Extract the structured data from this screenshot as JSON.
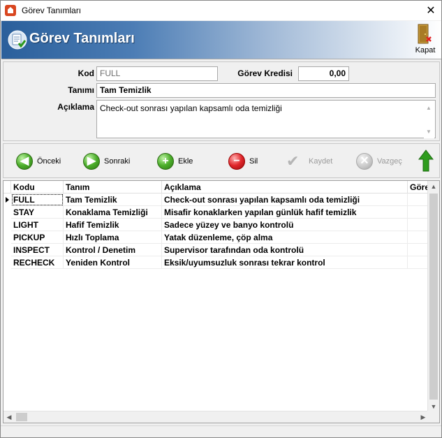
{
  "window": {
    "title": "Görev Tanımları"
  },
  "header": {
    "title": "Görev Tanımları",
    "close_label": "Kapat"
  },
  "form": {
    "kod_label": "Kod",
    "kod_value": "FULL",
    "kredi_label": "Görev Kredisi",
    "kredi_value": "0,00",
    "tanimi_label": "Tanımı",
    "tanimi_value": "Tam Temizlik",
    "aciklama_label": "Açıklama",
    "aciklama_value": "Check-out sonrası yapılan kapsamlı oda temizliği"
  },
  "toolbar": {
    "prev_label": "Önceki",
    "next_label": "Sonraki",
    "add_label": "Ekle",
    "delete_label": "Sil",
    "save_label": "Kaydet",
    "cancel_label": "Vazgeç"
  },
  "grid": {
    "columns": [
      "Kodu",
      "Tanım",
      "Açıklama",
      "Görev Kredisi"
    ],
    "rows": [
      {
        "kod": "FULL",
        "tanim": "Tam Temizlik",
        "aciklama": "Check-out sonrası yapılan kapsamlı oda temizliği"
      },
      {
        "kod": "STAY",
        "tanim": "Konaklama Temizliği",
        "aciklama": "Misafir konaklarken yapılan günlük hafif temizlik"
      },
      {
        "kod": "LIGHT",
        "tanim": "Hafif Temizlik",
        "aciklama": "Sadece yüzey ve banyo kontrolü"
      },
      {
        "kod": "PICKUP",
        "tanim": "Hızlı Toplama",
        "aciklama": "Yatak düzenleme, çöp alma"
      },
      {
        "kod": "INSPECT",
        "tanim": "Kontrol / Denetim",
        "aciklama": "Supervisor tarafından oda kontrolü"
      },
      {
        "kod": "RECHECK",
        "tanim": "Yeniden Kontrol",
        "aciklama": "Eksik/uyumsuzluk sonrası tekrar kontrol"
      }
    ]
  },
  "colors": {
    "header_gradient_start": "#2a5f9b",
    "green_button": "#4cae2b",
    "red_button": "#e0262a"
  },
  "icons": {
    "app": "app-icon",
    "header": "tasks-icon",
    "kapat": "door-exit-icon"
  }
}
